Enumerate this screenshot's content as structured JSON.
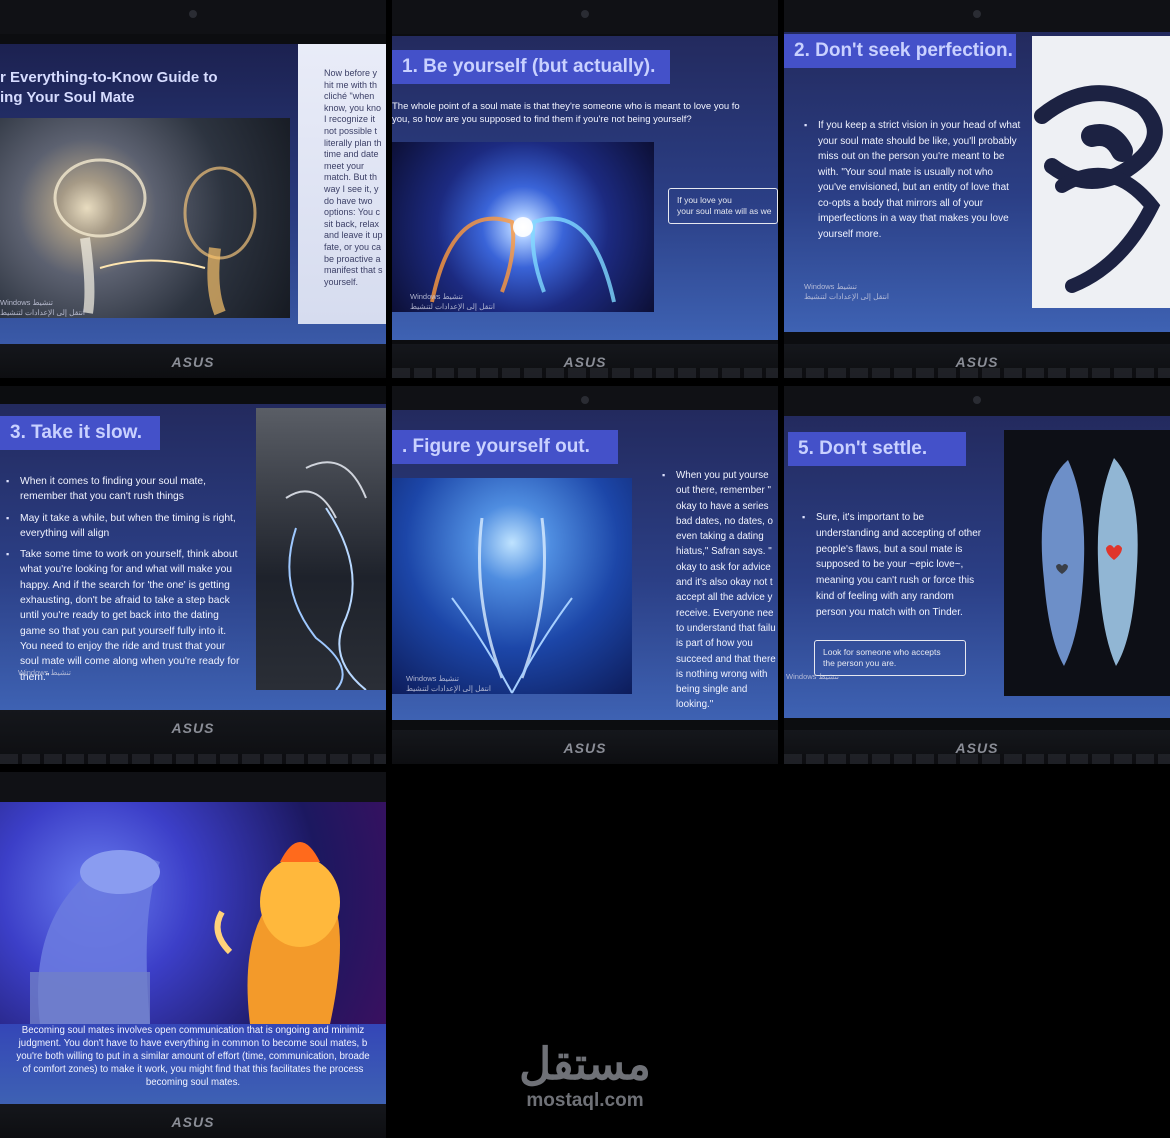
{
  "slides": [
    {
      "title": "r Everything-to-Know Guide to\ning Your Soul Mate",
      "body": "Now before y\nhit me with th\ncliché \"when \nknow, you kno\nI recognize it\nnot possible t\nliterally plan th\ntime and date\nmeet your\nmatch. But th\nway I see it, y\ndo have two\noptions: You c\nsit back, relax\nand leave it up\nfate, or you ca\nbe proactive a\nmanifest that s\nyourself.",
      "watermark": "Windows تنشيط\nانتقل إلى الإعدادات لتنشيط",
      "brand": "ASUS"
    },
    {
      "title": "1. Be yourself (but actually).",
      "subtitle": "The whole point of a soul mate is that they're someone who is meant to love you fo\nyou, so how are you supposed to find them if you're not being yourself?",
      "caption": "If you love you\nyour soul mate will as we",
      "watermark": "Windows تنشيط\nانتقل إلى الإعدادات لتنشيط",
      "brand": "ASUS"
    },
    {
      "title": "2. Don't seek perfection.",
      "bullets": [
        "If you keep a strict vision in your head of what your soul mate should be like, you'll probably miss out on the person you're meant to be with. \"Your soul mate is usually not who you've envisioned, but an entity of love that co-opts a body that mirrors all of your imperfections in a way that makes you love yourself more."
      ],
      "watermark": "Windows تنشيط\nانتقل إلى الإعدادات لتنشيط",
      "brand": "ASUS"
    },
    {
      "title": "3. Take it slow.",
      "bullets": [
        "When it comes to finding your soul mate, remember that you can't rush things",
        "May it take a while, but when the timing is right, everything will align",
        "Take some time to work on yourself, think about what you're looking for and what will make you happy. And if the search for 'the one' is getting exhausting, don't be afraid to take a step back until you're ready to get back into the dating game so that you can put yourself fully into it. You need to enjoy the ride and trust that your soul mate will come along when you're ready for them.\""
      ],
      "watermark": "Windows تنشيط",
      "brand": "ASUS"
    },
    {
      "title": ". Figure yourself out.",
      "bullets": [
        "When you put yourse out there, remember \" okay to have a series bad dates, no dates, o even taking a dating hiatus,\" Safran says. \" okay to ask for advice and it's also okay not t accept all the advice y receive. Everyone nee to understand that failu is part of how you succeed and that there is nothing wrong with being single and looking.\""
      ],
      "watermark": "Windows تنشيط\nانتقل إلى الإعدادات لتنشيط",
      "brand": "ASUS"
    },
    {
      "title": "5. Don't settle.",
      "bullets": [
        "Sure, it's important to be understanding and accepting of other people's flaws, but a soul mate is supposed to be your ~epic love~, meaning you can't rush or force this kind of feeling with any random person you match with on Tinder."
      ],
      "caption": "Look for someone who accepts\nthe person you are.",
      "watermark": "Windows تنشيط",
      "brand": "ASUS"
    },
    {
      "body": "Becoming soul mates involves open communication that is ongoing and minimiz\njudgment. You don't have to have everything in common to become soul mates, b\nyou're both willing to put in a similar amount of effort (time, communication, broade\nof comfort zones) to make it work, you might find that this facilitates the process\nbecoming soul mates.",
      "brand": "ASUS"
    }
  ],
  "logo": {
    "arabic": "مستقل",
    "latin": "mostaql.com"
  },
  "colors": {
    "title_box": "#4451c9",
    "title_text": "#c9d1ff",
    "slide_bg_top": "#232a5e",
    "slide_bg_bottom": "#3e62b3"
  },
  "icons": [
    "camera-icon",
    "asus-logo",
    "mostaql-logo"
  ]
}
